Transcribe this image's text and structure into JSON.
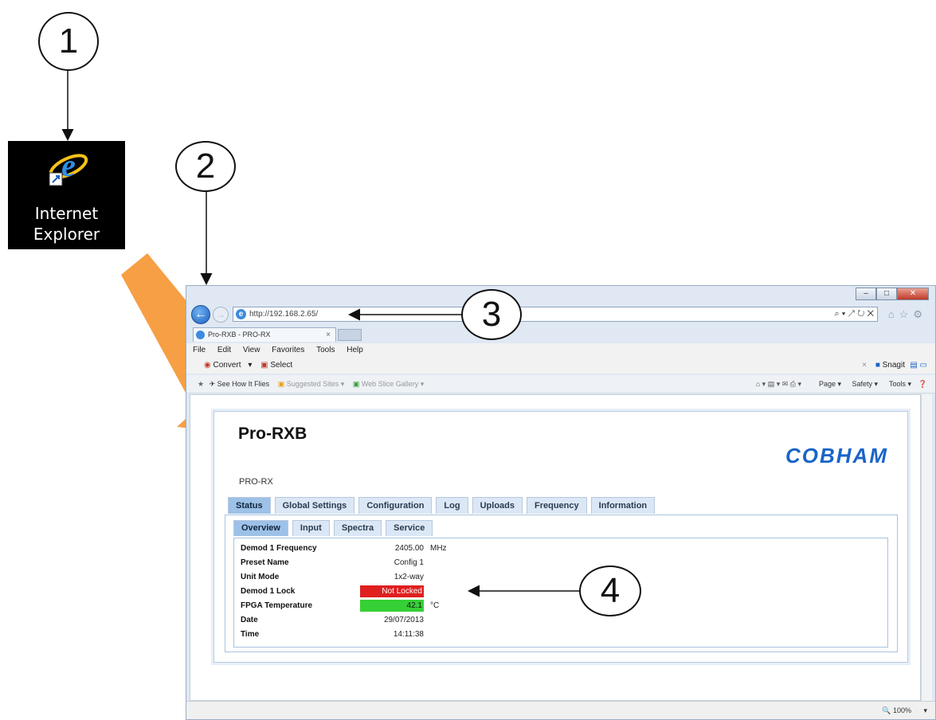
{
  "callouts": [
    "1",
    "2",
    "3",
    "4"
  ],
  "desktop_icon": {
    "line1": "Internet",
    "line2": "Explorer"
  },
  "browser": {
    "address": "http://192.168.2.65/",
    "address_tools": "⌕ ▾ ↗ ↻ ✕",
    "tab_title": "Pro-RXB - PRO-RX",
    "tab_close": "×",
    "menu": [
      "File",
      "Edit",
      "View",
      "Favorites",
      "Tools",
      "Help"
    ],
    "toolbar1": {
      "convert": "Convert",
      "select": "Select",
      "snagit": "Snagit"
    },
    "toolbar2": {
      "see_how": "See How It Flies",
      "suggested": "Suggested Sites ▾",
      "webslice": "Web Slice Gallery ▾",
      "page": "Page ▾",
      "safety": "Safety ▾",
      "tools": "Tools ▾"
    },
    "zoom": "100%"
  },
  "page": {
    "title": "Pro-RXB",
    "subtitle": "PRO-RX",
    "logo": "COBHAM",
    "main_tabs": [
      "Status",
      "Global Settings",
      "Configuration",
      "Log",
      "Uploads",
      "Frequency",
      "Information"
    ],
    "sub_tabs": [
      "Overview",
      "Input",
      "Spectra",
      "Service"
    ],
    "status_rows": [
      {
        "label": "Demod 1 Frequency",
        "value": "2405.00",
        "unit": "MHz"
      },
      {
        "label": "Preset Name",
        "value": "Config 1",
        "unit": ""
      },
      {
        "label": "Unit Mode",
        "value": "1x2-way",
        "unit": ""
      },
      {
        "label": "Demod 1 Lock",
        "value": "Not Locked",
        "unit": ""
      },
      {
        "label": "FPGA Temperature",
        "value": "42.1",
        "unit": "°C"
      },
      {
        "label": "Date",
        "value": "29/07/2013",
        "unit": ""
      },
      {
        "label": "Time",
        "value": "14:11:38",
        "unit": ""
      }
    ]
  },
  "colors": {
    "accent": "#1a64c8",
    "not_locked": "#e01f1f",
    "temp_ok": "#35d035",
    "arrow_orange": "#f59a3a"
  }
}
